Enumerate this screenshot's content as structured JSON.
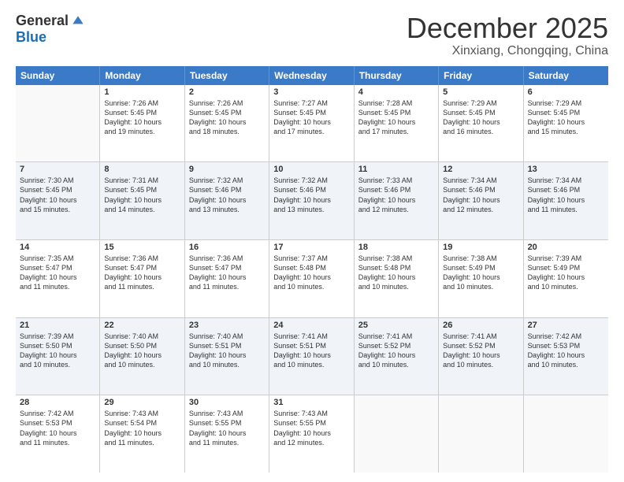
{
  "header": {
    "logo_general": "General",
    "logo_blue": "Blue",
    "month_title": "December 2025",
    "location": "Xinxiang, Chongqing, China"
  },
  "calendar": {
    "days_of_week": [
      "Sunday",
      "Monday",
      "Tuesday",
      "Wednesday",
      "Thursday",
      "Friday",
      "Saturday"
    ],
    "weeks": [
      [
        {
          "day": "",
          "info": ""
        },
        {
          "day": "1",
          "info": "Sunrise: 7:26 AM\nSunset: 5:45 PM\nDaylight: 10 hours\nand 19 minutes."
        },
        {
          "day": "2",
          "info": "Sunrise: 7:26 AM\nSunset: 5:45 PM\nDaylight: 10 hours\nand 18 minutes."
        },
        {
          "day": "3",
          "info": "Sunrise: 7:27 AM\nSunset: 5:45 PM\nDaylight: 10 hours\nand 17 minutes."
        },
        {
          "day": "4",
          "info": "Sunrise: 7:28 AM\nSunset: 5:45 PM\nDaylight: 10 hours\nand 17 minutes."
        },
        {
          "day": "5",
          "info": "Sunrise: 7:29 AM\nSunset: 5:45 PM\nDaylight: 10 hours\nand 16 minutes."
        },
        {
          "day": "6",
          "info": "Sunrise: 7:29 AM\nSunset: 5:45 PM\nDaylight: 10 hours\nand 15 minutes."
        }
      ],
      [
        {
          "day": "7",
          "info": "Sunrise: 7:30 AM\nSunset: 5:45 PM\nDaylight: 10 hours\nand 15 minutes."
        },
        {
          "day": "8",
          "info": "Sunrise: 7:31 AM\nSunset: 5:45 PM\nDaylight: 10 hours\nand 14 minutes."
        },
        {
          "day": "9",
          "info": "Sunrise: 7:32 AM\nSunset: 5:46 PM\nDaylight: 10 hours\nand 13 minutes."
        },
        {
          "day": "10",
          "info": "Sunrise: 7:32 AM\nSunset: 5:46 PM\nDaylight: 10 hours\nand 13 minutes."
        },
        {
          "day": "11",
          "info": "Sunrise: 7:33 AM\nSunset: 5:46 PM\nDaylight: 10 hours\nand 12 minutes."
        },
        {
          "day": "12",
          "info": "Sunrise: 7:34 AM\nSunset: 5:46 PM\nDaylight: 10 hours\nand 12 minutes."
        },
        {
          "day": "13",
          "info": "Sunrise: 7:34 AM\nSunset: 5:46 PM\nDaylight: 10 hours\nand 11 minutes."
        }
      ],
      [
        {
          "day": "14",
          "info": "Sunrise: 7:35 AM\nSunset: 5:47 PM\nDaylight: 10 hours\nand 11 minutes."
        },
        {
          "day": "15",
          "info": "Sunrise: 7:36 AM\nSunset: 5:47 PM\nDaylight: 10 hours\nand 11 minutes."
        },
        {
          "day": "16",
          "info": "Sunrise: 7:36 AM\nSunset: 5:47 PM\nDaylight: 10 hours\nand 11 minutes."
        },
        {
          "day": "17",
          "info": "Sunrise: 7:37 AM\nSunset: 5:48 PM\nDaylight: 10 hours\nand 10 minutes."
        },
        {
          "day": "18",
          "info": "Sunrise: 7:38 AM\nSunset: 5:48 PM\nDaylight: 10 hours\nand 10 minutes."
        },
        {
          "day": "19",
          "info": "Sunrise: 7:38 AM\nSunset: 5:49 PM\nDaylight: 10 hours\nand 10 minutes."
        },
        {
          "day": "20",
          "info": "Sunrise: 7:39 AM\nSunset: 5:49 PM\nDaylight: 10 hours\nand 10 minutes."
        }
      ],
      [
        {
          "day": "21",
          "info": "Sunrise: 7:39 AM\nSunset: 5:50 PM\nDaylight: 10 hours\nand 10 minutes."
        },
        {
          "day": "22",
          "info": "Sunrise: 7:40 AM\nSunset: 5:50 PM\nDaylight: 10 hours\nand 10 minutes."
        },
        {
          "day": "23",
          "info": "Sunrise: 7:40 AM\nSunset: 5:51 PM\nDaylight: 10 hours\nand 10 minutes."
        },
        {
          "day": "24",
          "info": "Sunrise: 7:41 AM\nSunset: 5:51 PM\nDaylight: 10 hours\nand 10 minutes."
        },
        {
          "day": "25",
          "info": "Sunrise: 7:41 AM\nSunset: 5:52 PM\nDaylight: 10 hours\nand 10 minutes."
        },
        {
          "day": "26",
          "info": "Sunrise: 7:41 AM\nSunset: 5:52 PM\nDaylight: 10 hours\nand 10 minutes."
        },
        {
          "day": "27",
          "info": "Sunrise: 7:42 AM\nSunset: 5:53 PM\nDaylight: 10 hours\nand 10 minutes."
        }
      ],
      [
        {
          "day": "28",
          "info": "Sunrise: 7:42 AM\nSunset: 5:53 PM\nDaylight: 10 hours\nand 11 minutes."
        },
        {
          "day": "29",
          "info": "Sunrise: 7:43 AM\nSunset: 5:54 PM\nDaylight: 10 hours\nand 11 minutes."
        },
        {
          "day": "30",
          "info": "Sunrise: 7:43 AM\nSunset: 5:55 PM\nDaylight: 10 hours\nand 11 minutes."
        },
        {
          "day": "31",
          "info": "Sunrise: 7:43 AM\nSunset: 5:55 PM\nDaylight: 10 hours\nand 12 minutes."
        },
        {
          "day": "",
          "info": ""
        },
        {
          "day": "",
          "info": ""
        },
        {
          "day": "",
          "info": ""
        }
      ]
    ]
  }
}
